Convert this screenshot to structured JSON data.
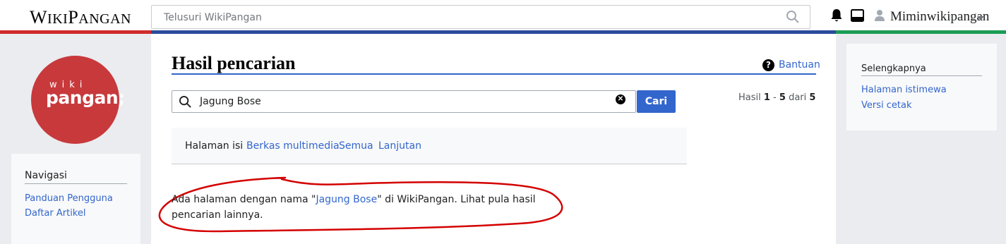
{
  "header": {
    "logo_first": "W",
    "logo_rest1": "IKI",
    "logo_p": "P",
    "logo_rest2": "ANGAN",
    "search_placeholder": "Telusuri WikiPangan",
    "username": "Miminwikipangan"
  },
  "sidebar": {
    "logo_top": "wiki",
    "logo_bottom": "pangan;",
    "nav_title": "Navigasi",
    "nav_items": [
      {
        "label": "Panduan Pengguna"
      },
      {
        "label": "Daftar Artikel"
      }
    ]
  },
  "main": {
    "title": "Hasil pencarian",
    "help_label": "Bantuan",
    "search_value": "Jagung Bose",
    "search_button": "Cari",
    "result_prefix": "Hasil ",
    "result_from": "1",
    "result_sep": " - ",
    "result_to": "5",
    "result_of": " dari ",
    "result_total": "5",
    "profiles": [
      {
        "label": "Halaman isi",
        "active": true
      },
      {
        "label": "Berkas multimedia",
        "active": false
      },
      {
        "label": "Semua",
        "active": false
      },
      {
        "label": "Lanjutan",
        "active": false
      }
    ],
    "info_before": "Ada halaman dengan nama \"",
    "info_link": "Jagung Bose",
    "info_after": "\" di WikiPangan. Lihat pula hasil pencarian lainnya."
  },
  "right_sidebar": {
    "title": "Selengkapnya",
    "items": [
      {
        "label": "Halaman istimewa"
      },
      {
        "label": "Versi cetak"
      }
    ]
  },
  "colors": {
    "accent": "#3366cc",
    "stripe_red": "#d02b2e",
    "stripe_blue": "#2b4c9c",
    "stripe_green": "#1b9d56",
    "logo_circle": "#c8393c",
    "annotation": "#d40000"
  }
}
